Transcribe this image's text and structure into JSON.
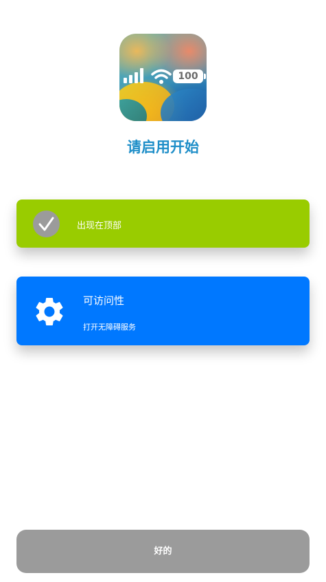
{
  "app_icon": {
    "battery_level": "100",
    "icon": "status-bar-app-icon"
  },
  "page": {
    "title": "请启用开始"
  },
  "cards": {
    "top_position": {
      "label": "出现在顶部",
      "icon": "check-icon",
      "color": "#99cc00"
    },
    "accessibility": {
      "heading": "可访问性",
      "subtitle": "打开无障碍服务",
      "icon": "gear-icon",
      "color": "#0078ff"
    }
  },
  "footer": {
    "ok_label": "好的"
  },
  "colors": {
    "title": "#1e8ec8",
    "button_gray": "#9b9b9b"
  }
}
